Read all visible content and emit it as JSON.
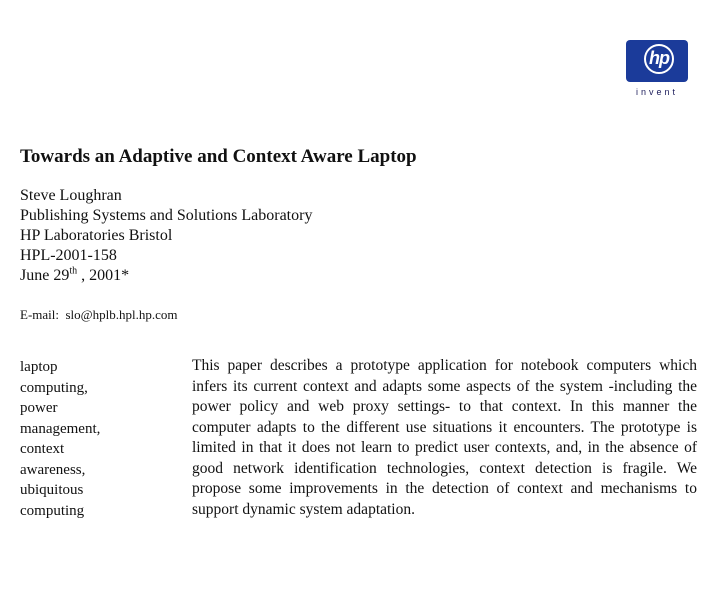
{
  "logo": {
    "brand": "hp",
    "tagline": "invent",
    "color": "#1b3b9a"
  },
  "title": "Towards an Adaptive and Context Aware Laptop",
  "author": "Steve Loughran",
  "lab": "Publishing Systems and Solutions Laboratory",
  "location": "HP Laboratories Bristol",
  "report_id": "HPL-2001-158",
  "date": {
    "prefix": "June 29",
    "suffix": "th",
    "rest": " , 2001*"
  },
  "email": {
    "label": "E-mail:",
    "address": "slo@hplb.hpl.hp.com"
  },
  "keywords": [
    "laptop",
    "computing,",
    "power",
    "management,",
    "context",
    "awareness,",
    "ubiquitous",
    "computing"
  ],
  "abstract": "This paper describes a prototype application for notebook computers which infers its current context and adapts some aspects of the system -including the power policy and web proxy settings- to that context. In this manner the computer adapts to the different use situations it encounters. The prototype is limited in that it does not learn to predict user contexts, and, in the absence of good network identification technologies, context detection is fragile. We propose some improvements in the detection of context and mechanisms to support dynamic system adaptation."
}
